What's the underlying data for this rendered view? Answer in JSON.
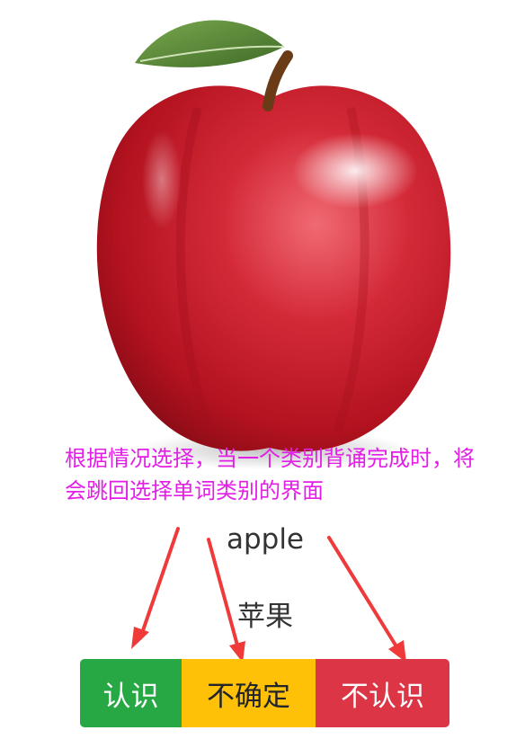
{
  "image": {
    "subject": "apple-icon",
    "colors": {
      "skin": "#c8202e",
      "skin_dark": "#8f0d1a",
      "highlight": "#ffd6d9",
      "leaf": "#5d8a3a",
      "stem": "#6b3a16"
    }
  },
  "annotation": {
    "text": "根据情况选择，当一个类别背诵完成时，将会跳回选择单词类别的界面",
    "color": "#e31ee6"
  },
  "card": {
    "word": "apple",
    "meaning": "苹果"
  },
  "buttons": {
    "know": {
      "label": "认识",
      "color": "#28a745"
    },
    "unsure": {
      "label": "不确定",
      "color": "#ffc107"
    },
    "unknown": {
      "label": "不认识",
      "color": "#dc3545"
    }
  },
  "arrow_color": "#f03a3a"
}
